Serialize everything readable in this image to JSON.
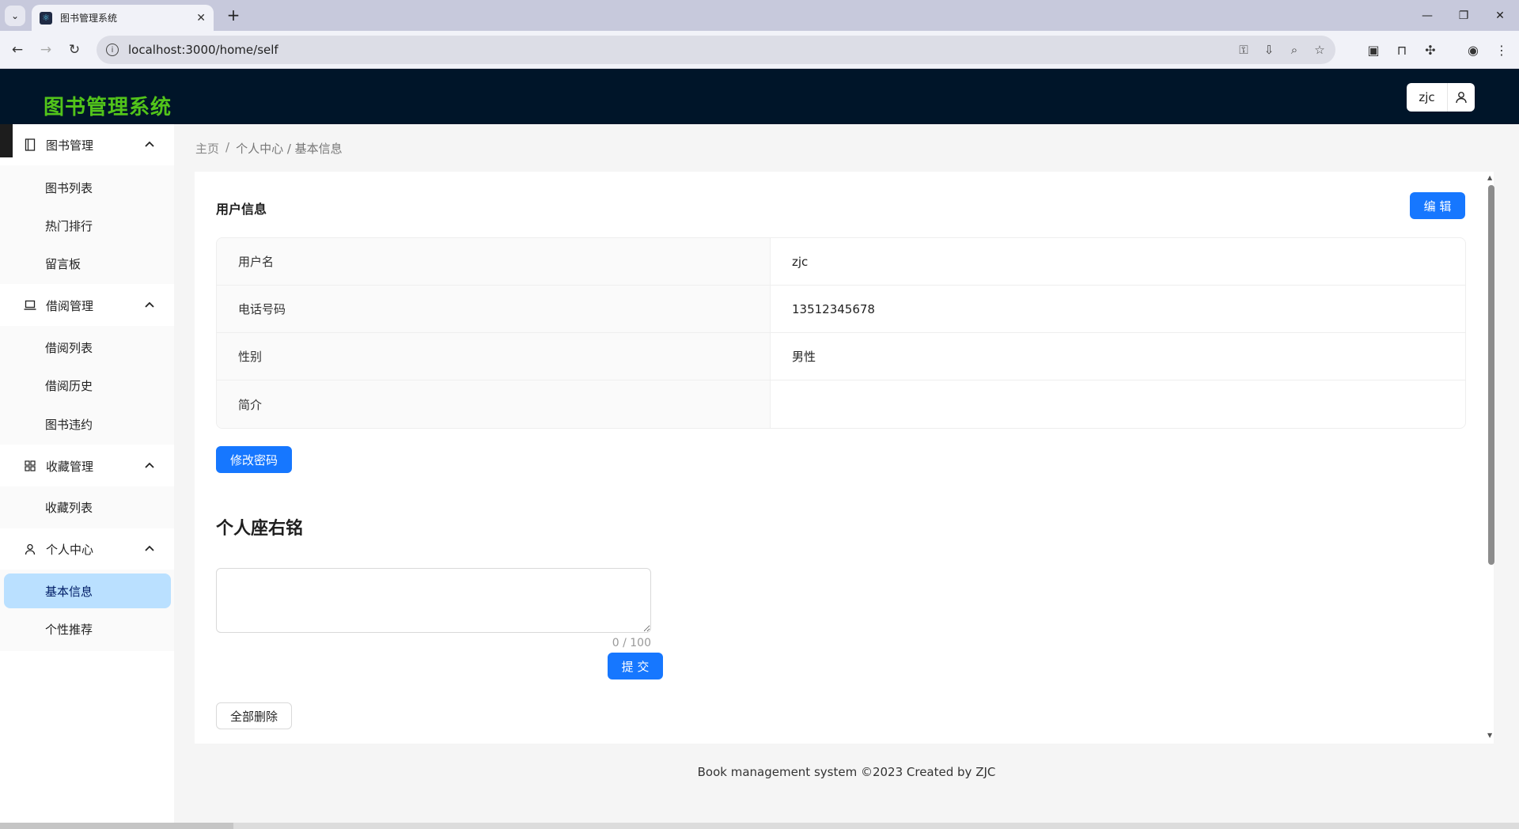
{
  "browser": {
    "tab_title": "图书管理系统",
    "url": "localhost:3000/home/self"
  },
  "header": {
    "logo": "图书管理系统",
    "username": "zjc"
  },
  "sidebar": {
    "groups": [
      {
        "label": "图书管理",
        "items": [
          "图书列表",
          "热门排行",
          "留言板"
        ]
      },
      {
        "label": "借阅管理",
        "items": [
          "借阅列表",
          "借阅历史",
          "图书违约"
        ]
      },
      {
        "label": "收藏管理",
        "items": [
          "收藏列表"
        ]
      },
      {
        "label": "个人中心",
        "items": [
          "基本信息",
          "个性推荐"
        ]
      }
    ],
    "active_item": "基本信息"
  },
  "breadcrumb": [
    "主页",
    "个人中心 / 基本信息"
  ],
  "user_info": {
    "title": "用户信息",
    "edit_label": "编 辑",
    "rows": [
      {
        "label": "用户名",
        "value": "zjc"
      },
      {
        "label": "电话号码",
        "value": "13512345678"
      },
      {
        "label": "性别",
        "value": "男性"
      },
      {
        "label": "简介",
        "value": ""
      }
    ],
    "change_password_label": "修改密码"
  },
  "motto": {
    "title": "个人座右铭",
    "value": "",
    "count": "0 / 100",
    "submit_label": "提 交",
    "delete_all_label": "全部删除"
  },
  "footer": "Book management system ©2023 Created by ZJC"
}
